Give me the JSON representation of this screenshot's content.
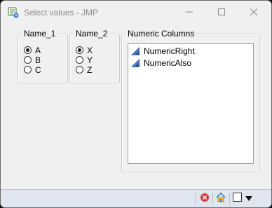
{
  "window": {
    "title": "Select values - JMP",
    "icon": "jmp-app-icon",
    "controls": [
      "minimize-icon",
      "maximize-icon",
      "close-icon"
    ]
  },
  "groups": [
    {
      "label": "Name_1",
      "options": [
        {
          "label": "A",
          "selected": true
        },
        {
          "label": "B",
          "selected": false
        },
        {
          "label": "C",
          "selected": false
        }
      ]
    },
    {
      "label": "Name_2",
      "options": [
        {
          "label": "X",
          "selected": true
        },
        {
          "label": "Y",
          "selected": false
        },
        {
          "label": "Z",
          "selected": false
        }
      ]
    }
  ],
  "numeric": {
    "label": "Numeric Columns",
    "items": [
      {
        "label": "NumericRight",
        "icon": "continuous-column-icon"
      },
      {
        "label": "NumericAlso",
        "icon": "continuous-column-icon"
      }
    ]
  },
  "statusbar": {
    "icons": [
      "red-x-icon",
      "home-icon",
      "window-square-icon",
      "dropdown-arrow-icon"
    ]
  },
  "colors": {
    "accent": "#2c5aa0",
    "status_bg": "#dfe6ef",
    "window_bg": "#f0f0f0"
  }
}
